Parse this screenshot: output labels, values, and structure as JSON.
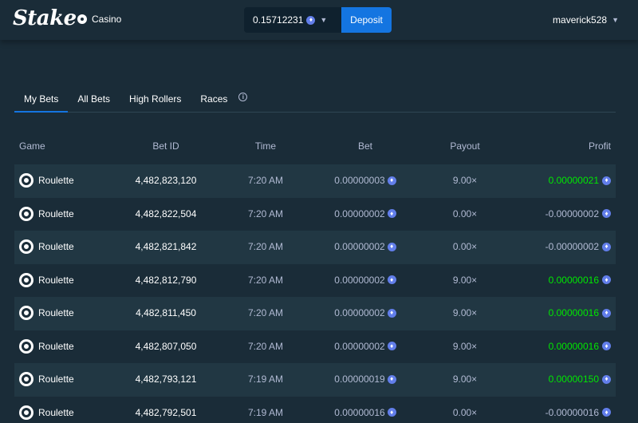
{
  "header": {
    "logo": "Stake",
    "nav_casino": "Casino",
    "balance": "0.15712231",
    "deposit_label": "Deposit",
    "username": "maverick528"
  },
  "tabs": [
    {
      "label": "My Bets",
      "active": true
    },
    {
      "label": "All Bets",
      "active": false
    },
    {
      "label": "High Rollers",
      "active": false
    },
    {
      "label": "Races",
      "active": false
    }
  ],
  "info_glyph": "i",
  "coin_glyph": "♦",
  "colors": {
    "background": "#1a2c38",
    "row_alt": "#213743",
    "accent_blue": "#1475e1",
    "profit_positive": "#00e701",
    "text_muted": "#b1bad3"
  },
  "table": {
    "headers": {
      "game": "Game",
      "bet_id": "Bet ID",
      "time": "Time",
      "bet": "Bet",
      "payout": "Payout",
      "profit": "Profit"
    },
    "rows": [
      {
        "game": "Roulette",
        "bet_id": "4,482,823,120",
        "time": "7:20 AM",
        "bet": "0.00000003",
        "payout": "9.00×",
        "profit": "0.00000021",
        "positive": true
      },
      {
        "game": "Roulette",
        "bet_id": "4,482,822,504",
        "time": "7:20 AM",
        "bet": "0.00000002",
        "payout": "0.00×",
        "profit": "-0.00000002",
        "positive": false
      },
      {
        "game": "Roulette",
        "bet_id": "4,482,821,842",
        "time": "7:20 AM",
        "bet": "0.00000002",
        "payout": "0.00×",
        "profit": "-0.00000002",
        "positive": false
      },
      {
        "game": "Roulette",
        "bet_id": "4,482,812,790",
        "time": "7:20 AM",
        "bet": "0.00000002",
        "payout": "9.00×",
        "profit": "0.00000016",
        "positive": true
      },
      {
        "game": "Roulette",
        "bet_id": "4,482,811,450",
        "time": "7:20 AM",
        "bet": "0.00000002",
        "payout": "9.00×",
        "profit": "0.00000016",
        "positive": true
      },
      {
        "game": "Roulette",
        "bet_id": "4,482,807,050",
        "time": "7:20 AM",
        "bet": "0.00000002",
        "payout": "9.00×",
        "profit": "0.00000016",
        "positive": true
      },
      {
        "game": "Roulette",
        "bet_id": "4,482,793,121",
        "time": "7:19 AM",
        "bet": "0.00000019",
        "payout": "9.00×",
        "profit": "0.00000150",
        "positive": true
      },
      {
        "game": "Roulette",
        "bet_id": "4,482,792,501",
        "time": "7:19 AM",
        "bet": "0.00000016",
        "payout": "0.00×",
        "profit": "-0.00000016",
        "positive": false
      }
    ]
  }
}
